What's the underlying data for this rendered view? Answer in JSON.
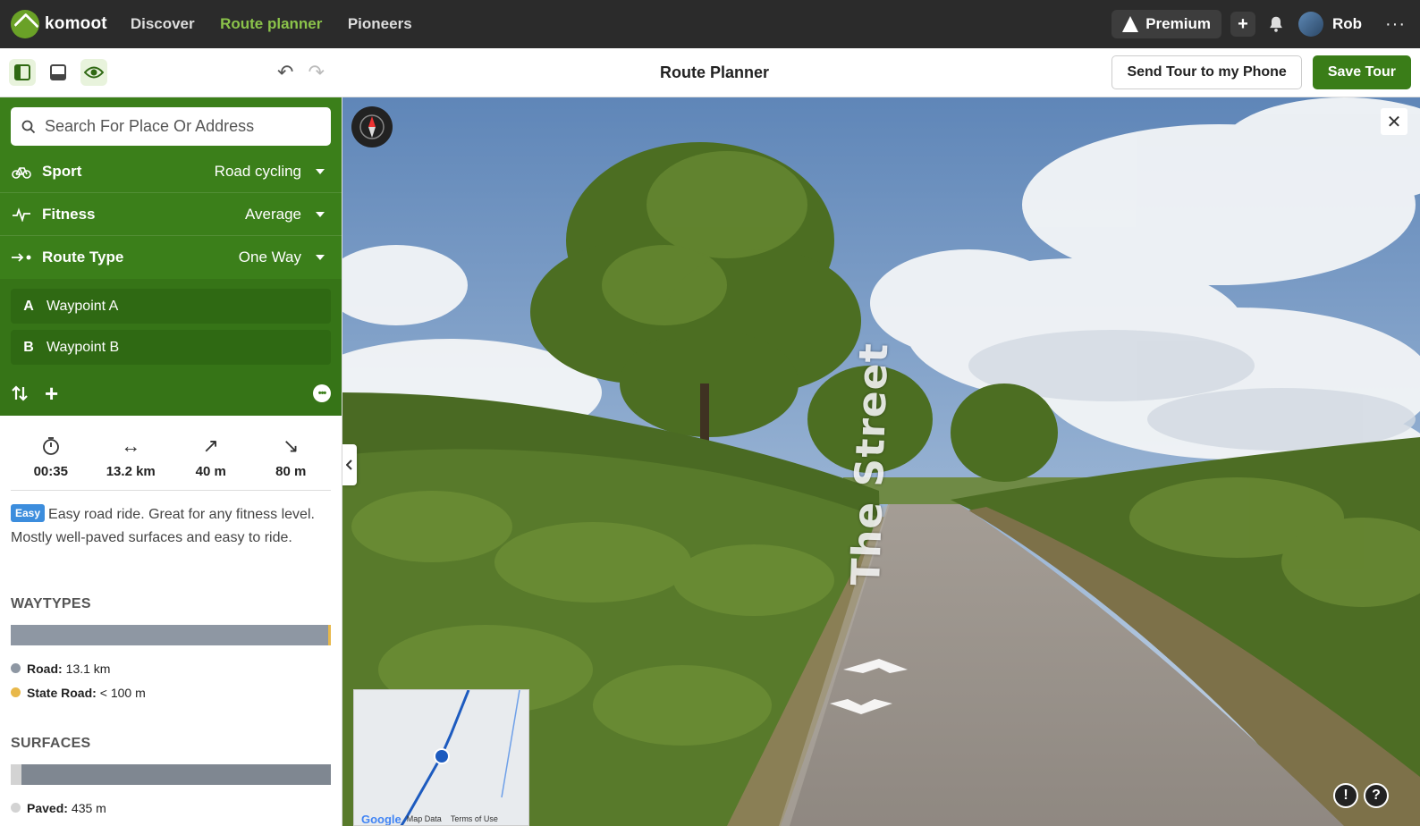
{
  "app": {
    "brand": "komoot"
  },
  "nav": {
    "discover": "Discover",
    "route_planner": "Route planner",
    "pioneers": "Pioneers"
  },
  "topbar": {
    "premium": "Premium",
    "user": "Rob",
    "more": "···"
  },
  "toolbar": {
    "title": "Route Planner",
    "send_to_phone": "Send Tour to my Phone",
    "save": "Save Tour"
  },
  "planner": {
    "search_placeholder": "Search For Place Or Address",
    "sport": {
      "label": "Sport",
      "value": "Road cycling"
    },
    "fitness": {
      "label": "Fitness",
      "value": "Average"
    },
    "route_type": {
      "label": "Route Type",
      "value": "One Way"
    },
    "waypoints": [
      {
        "letter": "A",
        "name": "Waypoint A"
      },
      {
        "letter": "B",
        "name": "Waypoint B"
      }
    ]
  },
  "stats": {
    "duration": "00:35",
    "distance": "13.2 km",
    "uphill": "40 m",
    "downhill": "80 m"
  },
  "difficulty": {
    "badge": "Easy",
    "text": "Easy road ride. Great for any fitness level. Mostly well-paved surfaces and easy to ride."
  },
  "waytypes": {
    "title": "WAYTYPES",
    "items": [
      {
        "label": "Road:",
        "value": "13.1 km",
        "color": "#8e97a3"
      },
      {
        "label": "State Road:",
        "value": "< 100 m",
        "color": "#e8b84a"
      }
    ]
  },
  "surfaces": {
    "title": "SURFACES",
    "items": [
      {
        "label": "Paved:",
        "value": "435 m",
        "color": "#d3d3d3"
      }
    ]
  },
  "map": {
    "street_label": "The Street",
    "minimap_footer": {
      "brand": "Google",
      "data": "Map Data",
      "terms": "Terms of Use"
    }
  },
  "colors": {
    "brand_green": "#3b7f1a",
    "accent_green": "#8bc34a",
    "dark": "#2b2b2b"
  }
}
